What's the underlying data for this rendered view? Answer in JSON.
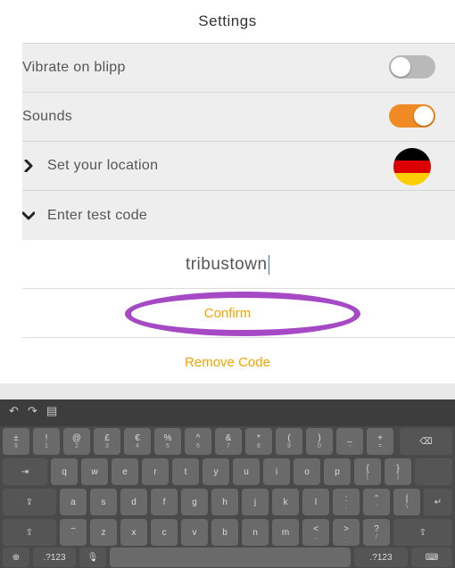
{
  "header": {
    "title": "Settings"
  },
  "settings": [
    {
      "label": "Vibrate on blipp",
      "control": "toggle",
      "state": "off"
    },
    {
      "label": "Sounds",
      "control": "toggle",
      "state": "on"
    },
    {
      "label": "Set your location",
      "control": "flag",
      "chevron": "right-icon",
      "flag_country_colors": [
        "#000000",
        "#dd0000",
        "#ffce00"
      ]
    },
    {
      "label": "Enter test code",
      "control": "none",
      "chevron": "down-icon"
    }
  ],
  "test_code": {
    "value": "tribustown"
  },
  "actions": {
    "confirm": "Confirm",
    "remove": "Remove Code"
  },
  "colors": {
    "accent": "#f0a500",
    "toggle_on": "#f08a24",
    "annotation": "#a649c4"
  },
  "keyboard": {
    "suggestion_icons": [
      "undo-icon",
      "redo-icon",
      "paste-icon"
    ],
    "row1": [
      {
        "main": "±",
        "sub": "§"
      },
      {
        "main": "!",
        "sub": "1"
      },
      {
        "main": "@",
        "sub": "2"
      },
      {
        "main": "£",
        "sub": "3"
      },
      {
        "main": "€",
        "sub": "4"
      },
      {
        "main": "%",
        "sub": "5"
      },
      {
        "main": "^",
        "sub": "6"
      },
      {
        "main": "&",
        "sub": "7"
      },
      {
        "main": "*",
        "sub": "8"
      },
      {
        "main": "(",
        "sub": "9"
      },
      {
        "main": ")",
        "sub": "0"
      },
      {
        "main": "_",
        "sub": "-"
      },
      {
        "main": "+",
        "sub": "="
      }
    ],
    "row2": [
      "q",
      "w",
      "e",
      "r",
      "t",
      "y",
      "u",
      "i",
      "o",
      "p"
    ],
    "row2_extra": [
      {
        "main": "{",
        "sub": "["
      },
      {
        "main": "}",
        "sub": "]"
      }
    ],
    "row3": [
      "a",
      "s",
      "d",
      "f",
      "g",
      "h",
      "j",
      "k",
      "l"
    ],
    "row3_extra": [
      {
        "main": ":",
        "sub": ";"
      },
      {
        "main": "\"",
        "sub": "'"
      },
      {
        "main": "|",
        "sub": "\\"
      }
    ],
    "row4": [
      {
        "main": "~",
        "sub": "`"
      },
      "z",
      "x",
      "c",
      "v",
      "b",
      "n",
      "m",
      {
        "main": "<",
        "sub": ","
      },
      {
        "main": ">",
        "sub": "."
      },
      {
        "main": "?",
        "sub": "/"
      }
    ],
    "numbers_label": ".?123",
    "numbers_label_right": ".?123"
  }
}
